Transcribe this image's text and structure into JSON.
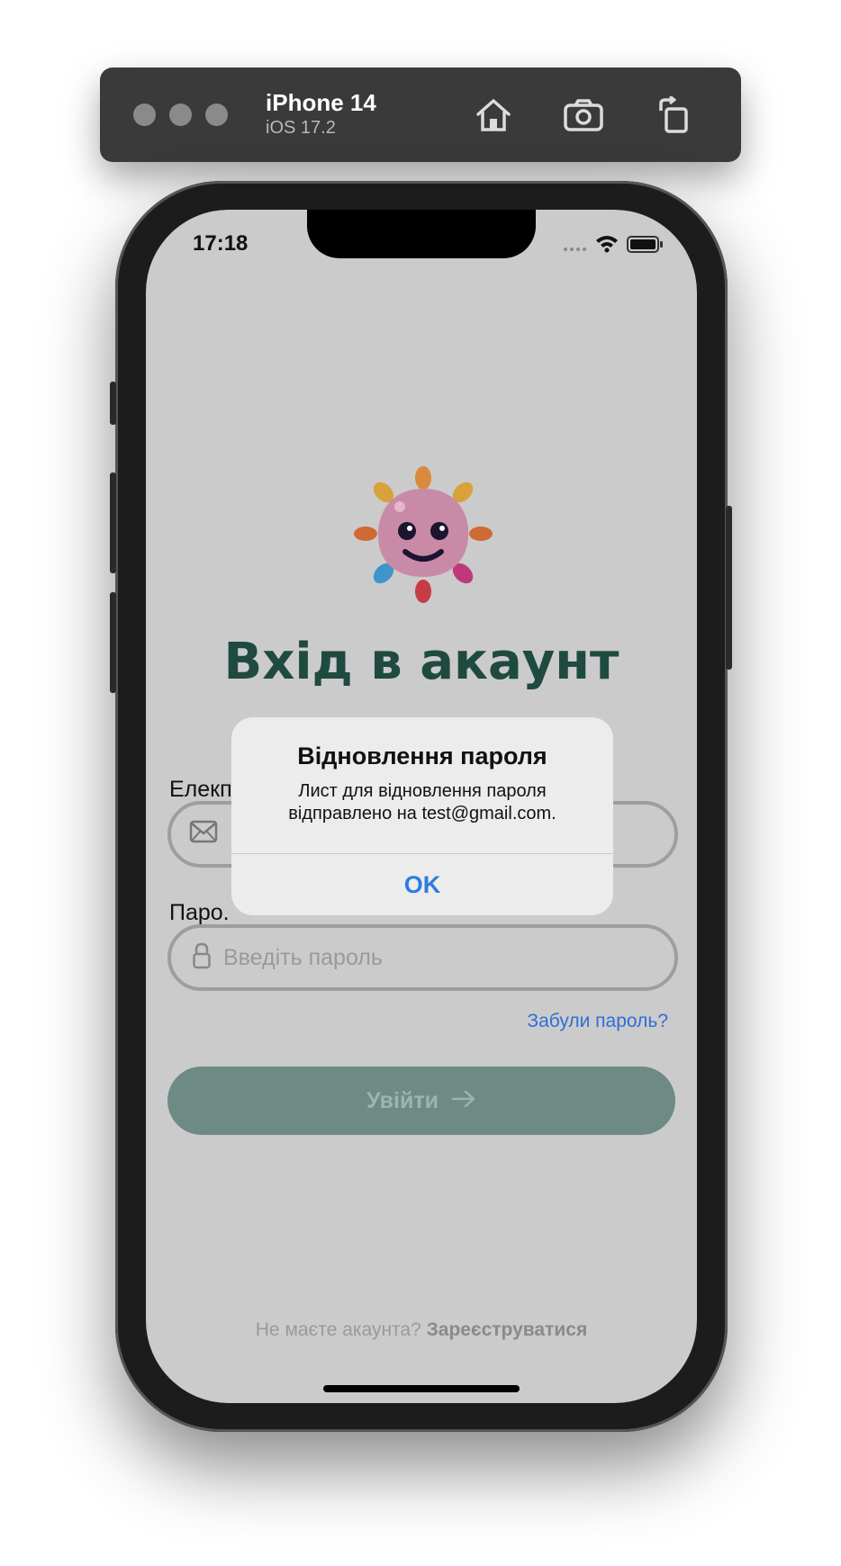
{
  "simulator": {
    "device_name": "iPhone 14",
    "os_version": "iOS 17.2",
    "toolbar_icons": [
      "home-icon",
      "screenshot-icon",
      "rotate-icon"
    ]
  },
  "status_bar": {
    "time": "17:18",
    "icons": [
      "cellular-signal-icon",
      "wifi-icon",
      "battery-icon"
    ]
  },
  "login": {
    "title": "Вхід в акаунт",
    "email_label": "Елекп",
    "password_label": "Паро.",
    "password_placeholder": "Введіть пароль",
    "forgot_password": "Забули пароль?",
    "login_button": "Увійти",
    "signup_prompt": "Не маєте акаунта?",
    "signup_link": "Зареєструватися"
  },
  "alert": {
    "title": "Відновлення пароля",
    "message_line1": "Лист для відновлення пароля",
    "message_line2": "відправлено на test@gmail.com.",
    "ok_button": "OK"
  },
  "colors": {
    "screen_background": "#cbcbcb",
    "title_color": "#1f4a40",
    "login_button": "#6e8a84",
    "link_color": "#2f6fd6",
    "alert_ok": "#2f7be0"
  }
}
